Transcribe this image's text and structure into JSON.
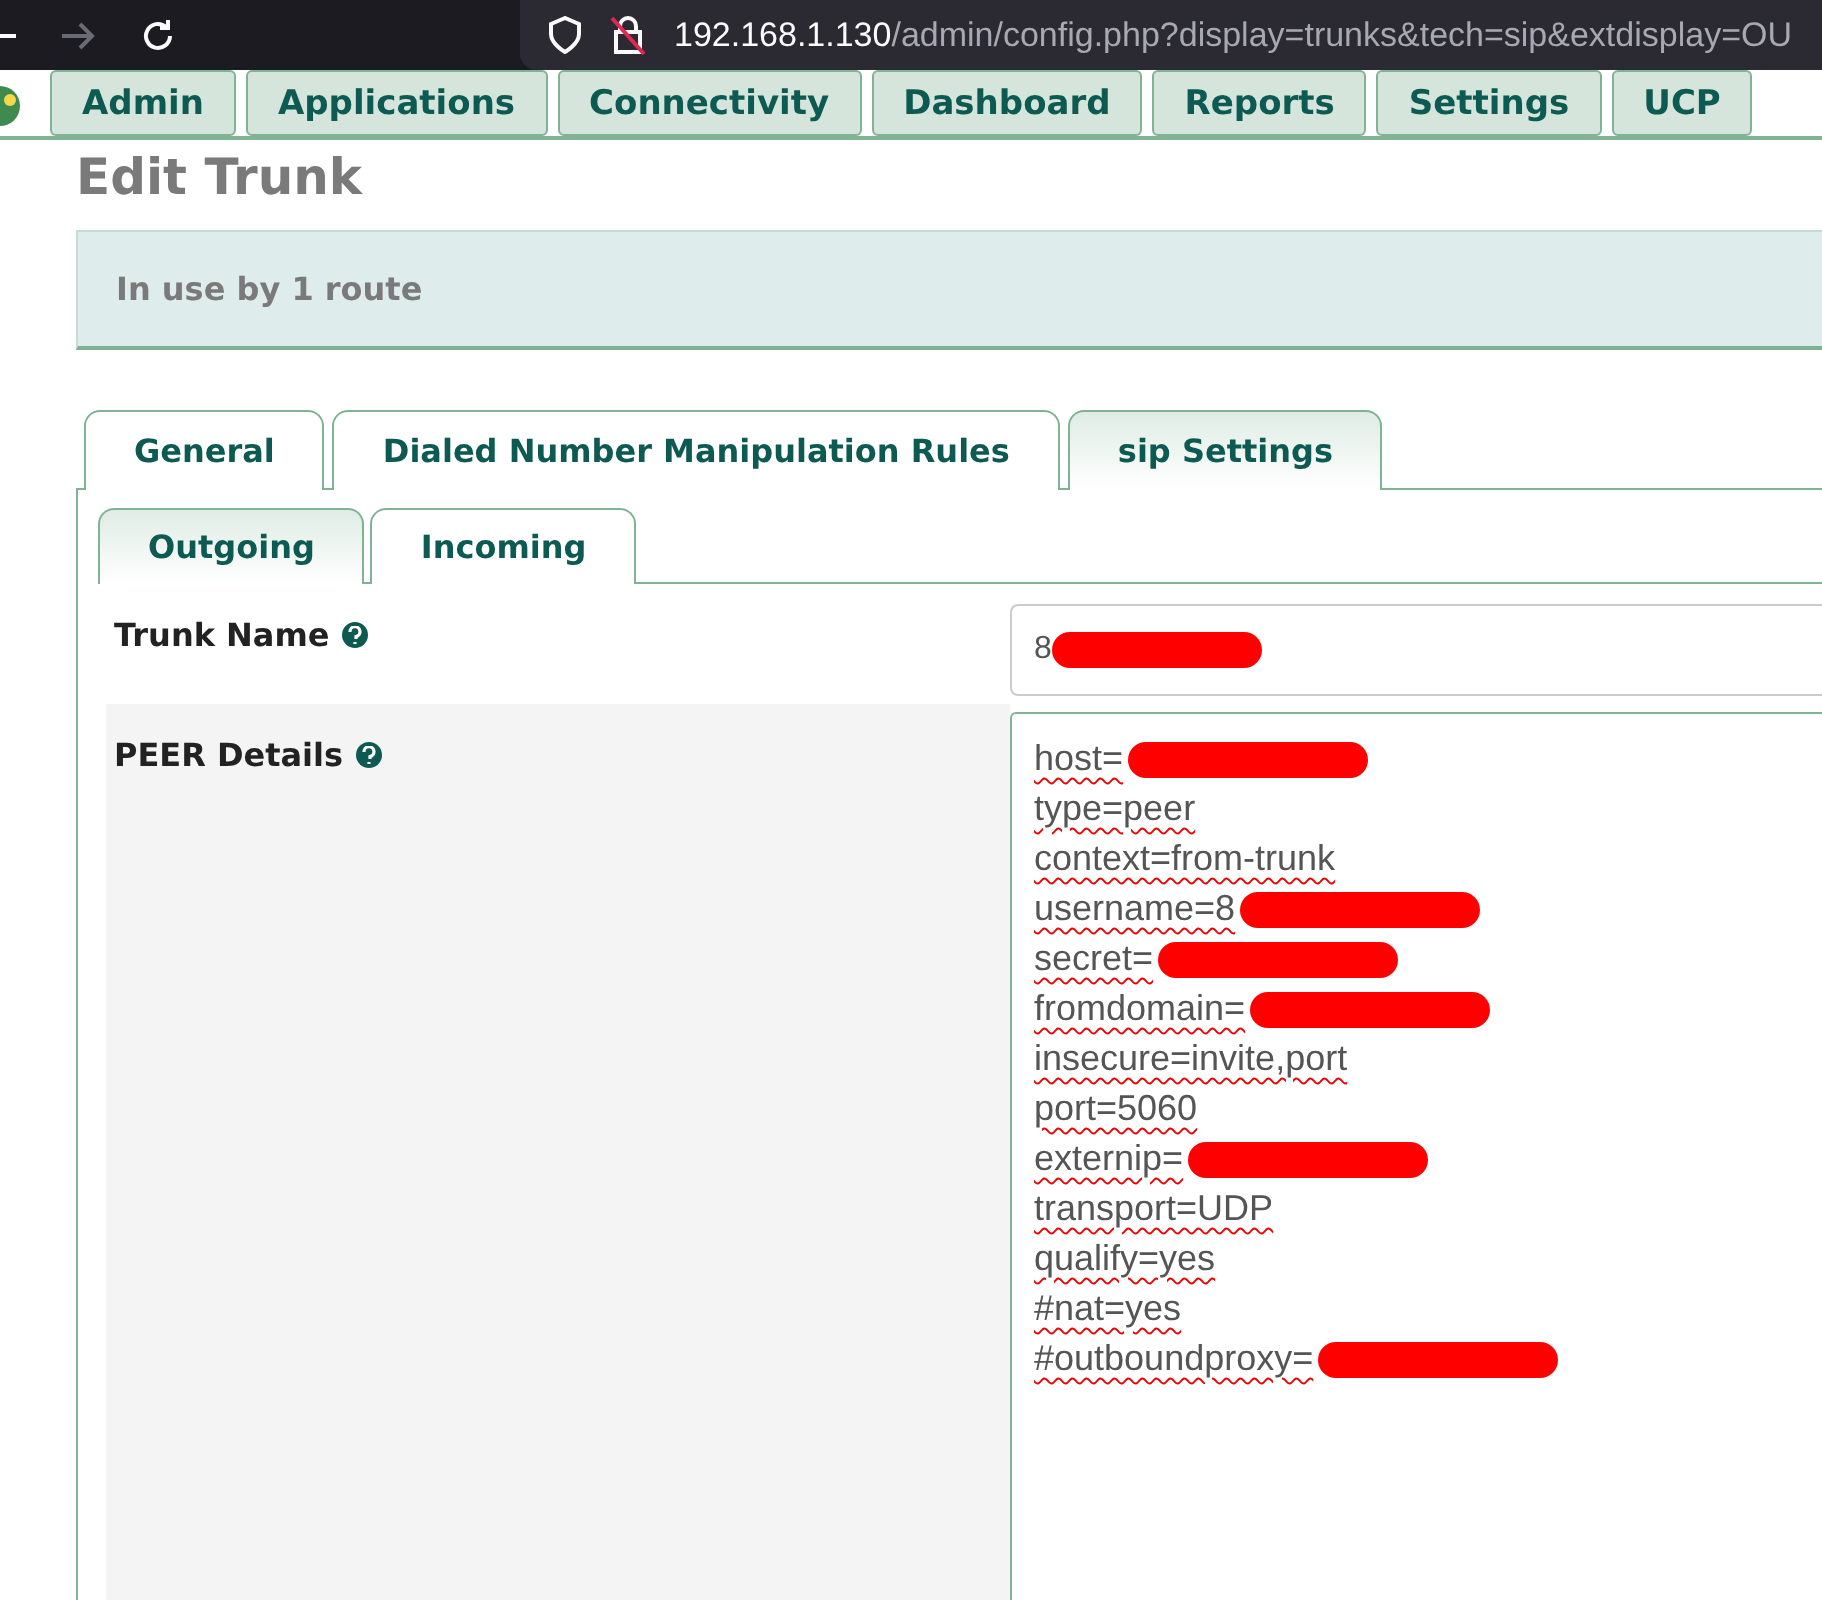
{
  "browser": {
    "url_host": "192.168.1.130",
    "url_path": "/admin/config.php?display=trunks&tech=sip&extdisplay=OU"
  },
  "nav": [
    "Admin",
    "Applications",
    "Connectivity",
    "Dashboard",
    "Reports",
    "Settings",
    "UCP"
  ],
  "page_title": "Edit Trunk",
  "notice": "In use by 1 route",
  "tabs": [
    {
      "label": "General",
      "selected": false
    },
    {
      "label": "Dialed Number Manipulation Rules",
      "selected": false
    },
    {
      "label": "sip Settings",
      "selected": true
    }
  ],
  "subtabs": [
    {
      "label": "Outgoing",
      "selected": true
    },
    {
      "label": "Incoming",
      "selected": false
    }
  ],
  "trunk_name": {
    "label": "Trunk Name",
    "value": "8",
    "redacted": true
  },
  "peer_details": {
    "label": "PEER Details",
    "lines": [
      {
        "text": "host=",
        "redacted": true
      },
      {
        "text": "type=peer",
        "redacted": false
      },
      {
        "text": "context=from-trunk",
        "redacted": false
      },
      {
        "text": "username=8",
        "redacted": true
      },
      {
        "text": "secret=",
        "redacted": true
      },
      {
        "text": "fromdomain=",
        "redacted": true
      },
      {
        "text": "insecure=invite,port",
        "redacted": false
      },
      {
        "text": "port=5060",
        "redacted": false
      },
      {
        "text": "externip=",
        "redacted": true
      },
      {
        "text": "transport=UDP",
        "redacted": false
      },
      {
        "text": "qualify=yes",
        "redacted": false
      },
      {
        "text": "#nat=yes",
        "redacted": false
      },
      {
        "text": "#outboundproxy=",
        "redacted": true
      }
    ]
  }
}
